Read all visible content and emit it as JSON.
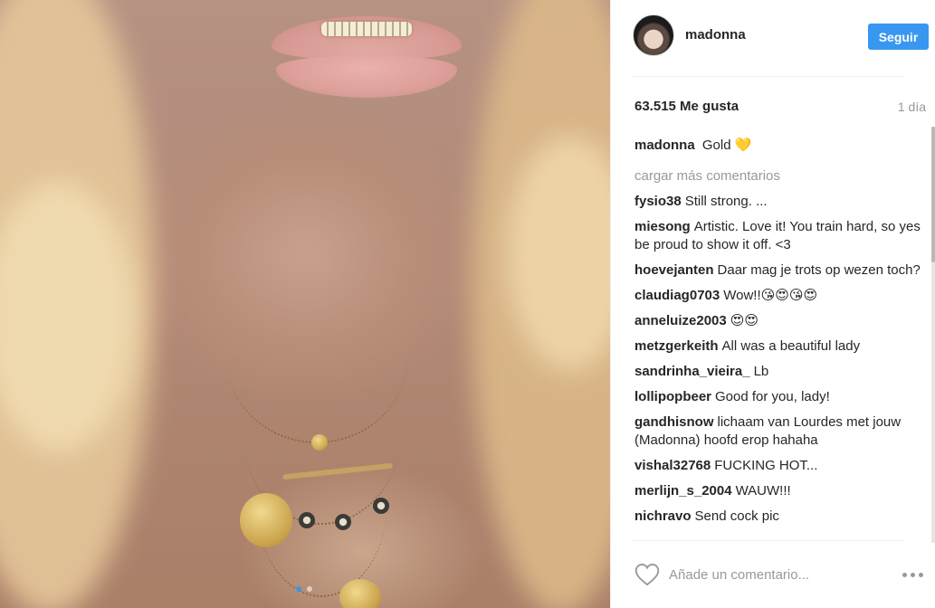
{
  "post": {
    "carousel": {
      "slide_count": 2,
      "active_index": 0
    }
  },
  "header": {
    "username": "madonna",
    "follow_label": "Seguir"
  },
  "stats": {
    "likes": "63.515 Me gusta",
    "time": "1 día"
  },
  "caption": {
    "user": "madonna",
    "text": "Gold",
    "emoji": "💛"
  },
  "load_more": "cargar más comentarios",
  "comments": [
    {
      "user": "fysio38",
      "text": "Still strong. ..."
    },
    {
      "user": "miesong",
      "text": "Artistic. Love it! You train hard, so yes be proud to show it off. <3"
    },
    {
      "user": "hoevejanten",
      "text": "Daar mag je trots op wezen toch?"
    },
    {
      "user": "claudiag0703",
      "text": "Wow!!😘😍😘😍"
    },
    {
      "user": "anneluize2003",
      "text": "😍😍"
    },
    {
      "user": "metzgerkeith",
      "text": "All was a beautiful lady"
    },
    {
      "user": "sandrinha_vieira_",
      "text": "Lb"
    },
    {
      "user": "lollipopbeer",
      "text": "Good for you, lady!"
    },
    {
      "user": "gandhisnow",
      "text": "lichaam van Lourdes met jouw (Madonna) hoofd erop hahaha"
    },
    {
      "user": "vishal32768",
      "text": "FUCKING HOT..."
    },
    {
      "user": "merlijn_s_2004",
      "text": "WAUW!!!"
    },
    {
      "user": "nichravo",
      "text": "Send cock pic"
    }
  ],
  "footer": {
    "comment_placeholder": "Añade un comentario...",
    "like_icon": "heart-outline-icon",
    "more_icon": "more-options-icon"
  },
  "colors": {
    "accent": "#3897f0",
    "muted": "#999999",
    "text": "#262626"
  }
}
